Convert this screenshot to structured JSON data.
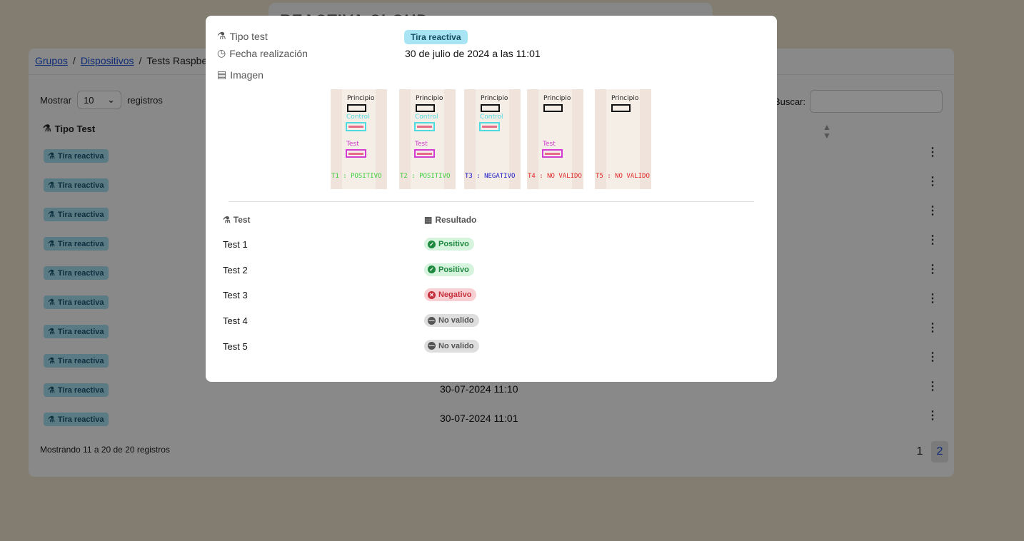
{
  "app": {
    "brand": "REACTIVA CLOUD"
  },
  "breadcrumb": {
    "groups": "Grupos",
    "devices": "Dispositivos",
    "current": "Tests Raspberry"
  },
  "controls": {
    "show_label": "Mostrar",
    "page_length": "10",
    "records_label": "registros",
    "search_label": "Buscar:",
    "search_value": ""
  },
  "table": {
    "headers": {
      "type": "Tipo Test"
    },
    "rows": [
      {
        "type": "Tira reactiva",
        "date": ""
      },
      {
        "type": "Tira reactiva",
        "date": ""
      },
      {
        "type": "Tira reactiva",
        "date": ""
      },
      {
        "type": "Tira reactiva",
        "date": ""
      },
      {
        "type": "Tira reactiva",
        "date": ""
      },
      {
        "type": "Tira reactiva",
        "date": ""
      },
      {
        "type": "Tira reactiva",
        "date": ""
      },
      {
        "type": "Tira reactiva",
        "date": ""
      },
      {
        "type": "Tira reactiva",
        "date": "30-07-2024 11:10"
      },
      {
        "type": "Tira reactiva",
        "date": "30-07-2024 11:01"
      }
    ],
    "info": "Mostrando 11 a 20 de 20 registros",
    "pages": [
      "1",
      "2"
    ],
    "active_page": "2"
  },
  "modal": {
    "type_label": "Tipo test",
    "type_value": "Tira reactiva",
    "date_label": "Fecha realización",
    "date_value": "30 de julio de 2024 a las 11:01",
    "image_label": "Imagen",
    "strips": [
      {
        "top": "Principio",
        "control": "Control",
        "test": "Test",
        "result": "T1 : POSITIVO",
        "color": "#3ccf3c"
      },
      {
        "top": "Principio",
        "control": "Control",
        "test": "Test",
        "result": "T2 : POSITIVO",
        "color": "#3ccf3c"
      },
      {
        "top": "Principio",
        "control": "Control",
        "test": "",
        "result": "T3 : NEGATIVO",
        "color": "#1b1bc7"
      },
      {
        "top": "Principio",
        "control": "",
        "test": "Test",
        "result": "T4 : NO VALIDO",
        "color": "#e02828"
      },
      {
        "top": "Principio",
        "control": "",
        "test": "",
        "result": "T5 : NO VALIDO",
        "color": "#e02828"
      }
    ],
    "results_headers": {
      "test": "Test",
      "result": "Resultado"
    },
    "results": [
      {
        "name": "Test 1",
        "status": "Positivo",
        "kind": "positive"
      },
      {
        "name": "Test 2",
        "status": "Positivo",
        "kind": "positive"
      },
      {
        "name": "Test 3",
        "status": "Negativo",
        "kind": "negative"
      },
      {
        "name": "Test 4",
        "status": "No valido",
        "kind": "invalid"
      },
      {
        "name": "Test 5",
        "status": "No valido",
        "kind": "invalid"
      }
    ],
    "colors": {
      "positive_bg": "#d6f3de",
      "positive_fg": "#1f8a3f",
      "negative_bg": "#f8d0d3",
      "negative_fg": "#c62f3c",
      "invalid_bg": "#dedede",
      "invalid_fg": "#555555"
    }
  }
}
